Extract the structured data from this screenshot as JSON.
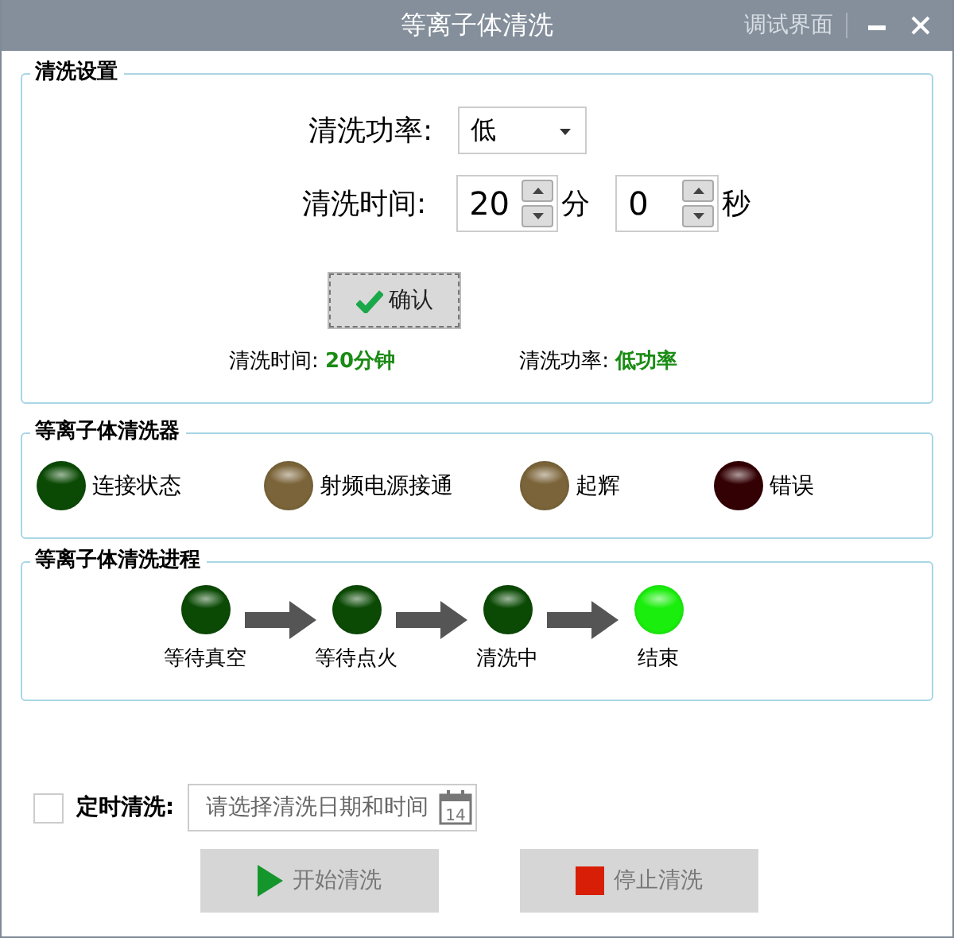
{
  "window": {
    "title": "等离子体清洗",
    "debug_link": "调试界面"
  },
  "settings": {
    "title": "清洗设置",
    "power_label": "清洗功率:",
    "power_value": "低",
    "time_label": "清洗时间:",
    "minutes": "20",
    "minutes_unit": "分",
    "seconds": "0",
    "seconds_unit": "秒",
    "confirm": "确认",
    "summary": [
      {
        "label": "清洗时间: ",
        "value": "20分钟"
      },
      {
        "label": "清洗功率: ",
        "value": "低功率"
      }
    ]
  },
  "device": {
    "title": "等离子体清洗器",
    "lamps": [
      {
        "label": "连接状态",
        "color": "#0b4a05"
      },
      {
        "label": "射频电源接通",
        "color": "#7b6439"
      },
      {
        "label": "起辉",
        "color": "#7b6439"
      },
      {
        "label": "错误",
        "color": "#330003"
      }
    ]
  },
  "process": {
    "title": "等离子体清洗进程",
    "steps": [
      {
        "label": "等待真空",
        "color": "#0b4a05"
      },
      {
        "label": "等待点火",
        "color": "#0b4a05"
      },
      {
        "label": "清洗中",
        "color": "#0b4a05"
      },
      {
        "label": "结束",
        "color": "#1aee0c"
      }
    ]
  },
  "schedule": {
    "checked": false,
    "label": "定时清洗:",
    "placeholder": "请选择清洗日期和时间",
    "calendar_day": "14"
  },
  "buttons": [
    {
      "kind": "start",
      "label": "开始清洗",
      "disabled": true
    },
    {
      "kind": "stop",
      "label": "停止清洗",
      "disabled": true
    }
  ]
}
